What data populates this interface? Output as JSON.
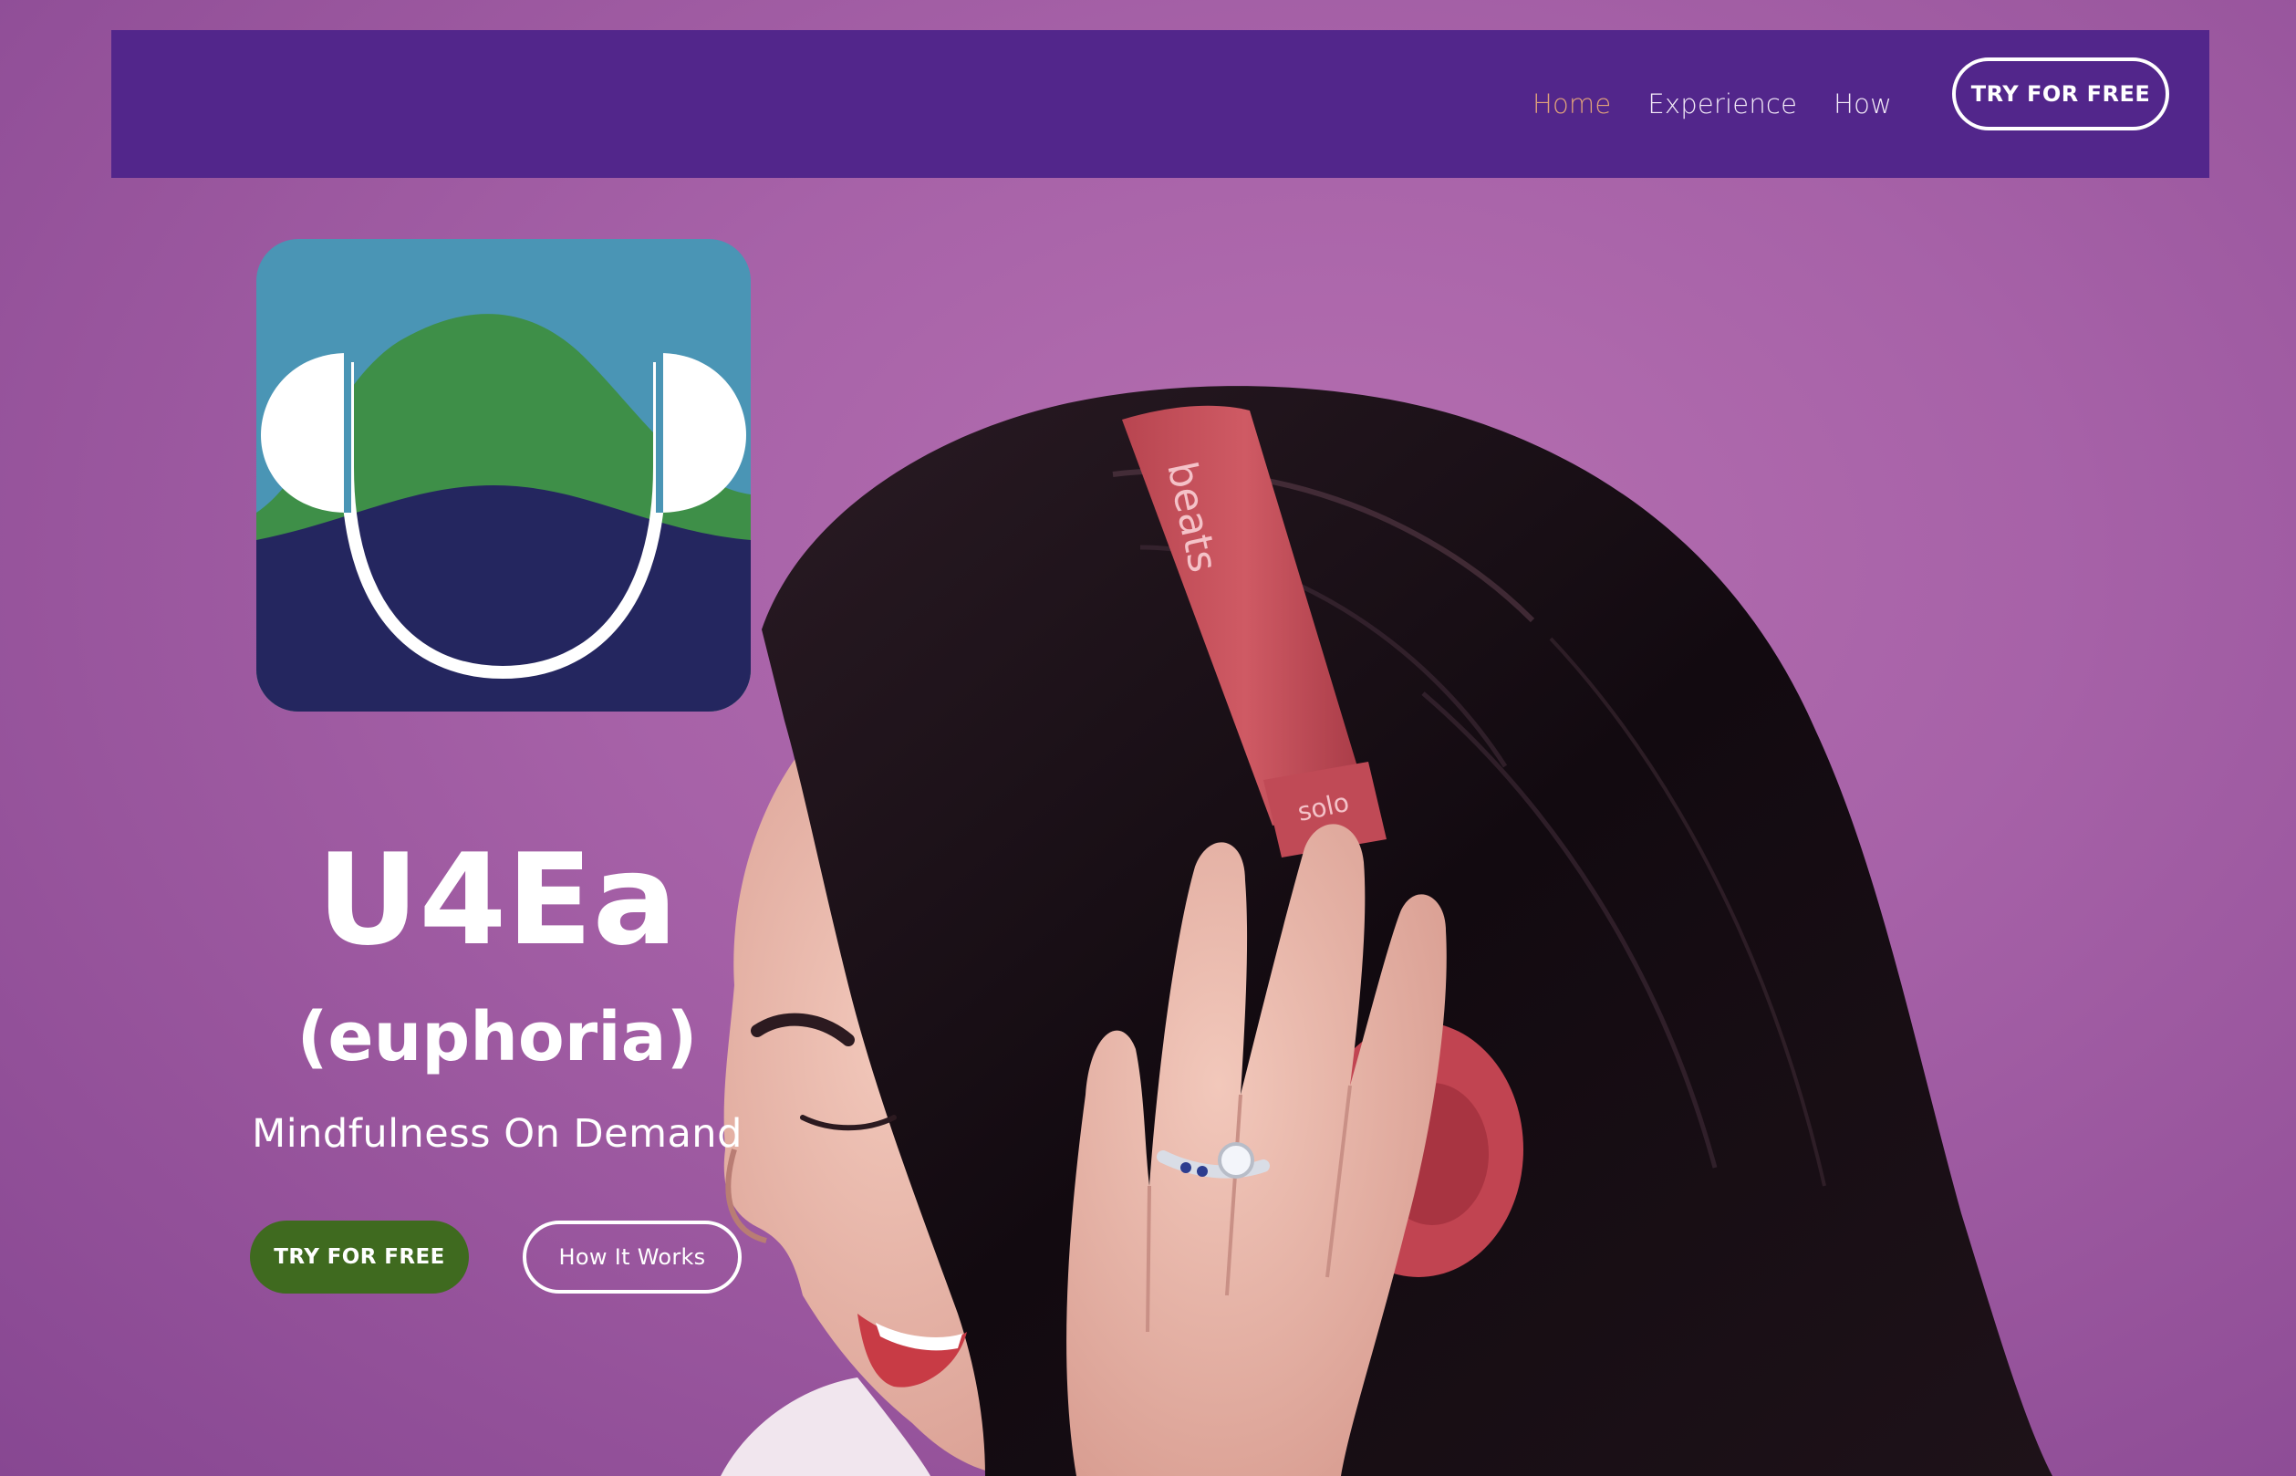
{
  "nav": {
    "links": [
      "Home",
      "Experience",
      "How"
    ],
    "active_index": 0,
    "cta_label": "TRY FOR FREE"
  },
  "hero": {
    "title": "U4Ea",
    "subtitle": "(euphoria)",
    "tagline": "Mindfulness On Demand",
    "primary_button": "TRY FOR FREE",
    "secondary_button": "How It Works"
  },
  "photo": {
    "headphone_band_text": "beats",
    "headphone_slider_text": "solo"
  },
  "colors": {
    "nav_bg": "#52268b",
    "nav_active": "#e0a27a",
    "primary_button_bg": "#3f6a1f",
    "page_bg": "#a762a8",
    "logo_sky": "#4a95b5",
    "logo_hill": "#3e8f48",
    "logo_lake": "#24265f"
  },
  "icons": {
    "logo": "headphones-landscape-logo-icon"
  }
}
